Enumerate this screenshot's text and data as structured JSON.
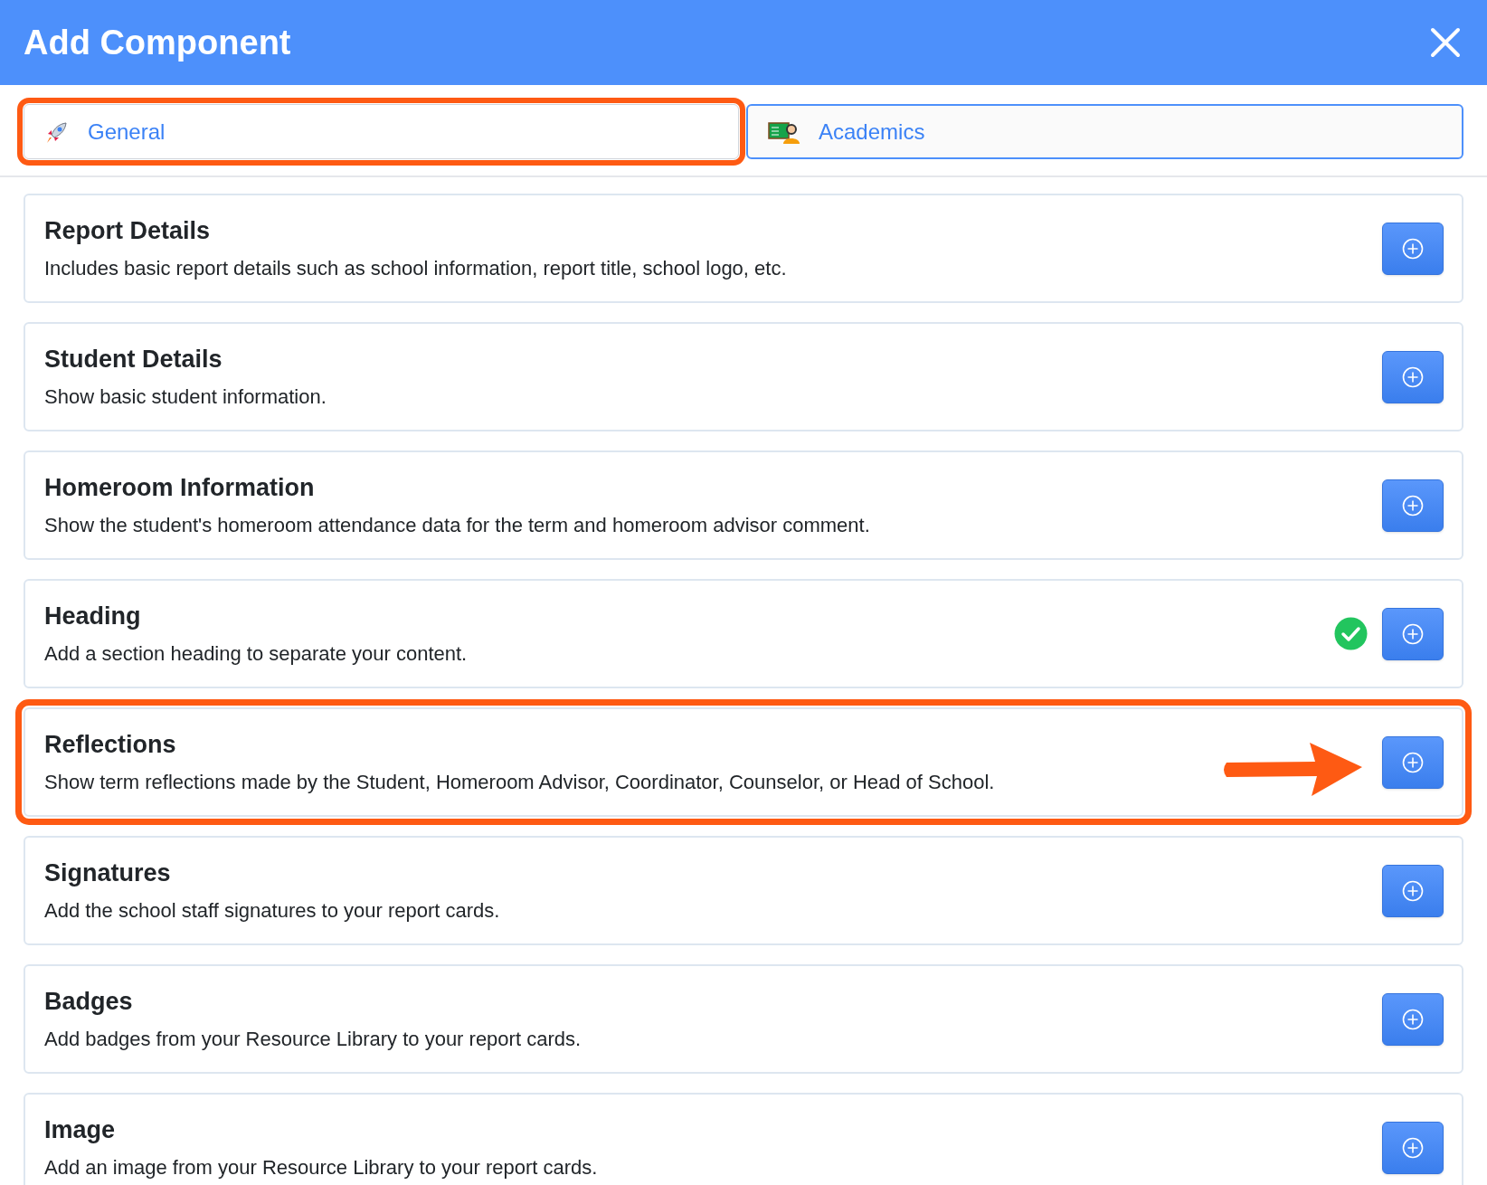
{
  "dialog": {
    "title": "Add Component"
  },
  "tabs": [
    {
      "label": "General",
      "selected": true,
      "highlighted": true
    },
    {
      "label": "Academics",
      "selected": false,
      "highlighted": false
    }
  ],
  "components": [
    {
      "title": "Report Details",
      "description": "Includes basic report details such as school information, report title, school logo, etc.",
      "added": false,
      "highlighted": false
    },
    {
      "title": "Student Details",
      "description": "Show basic student information.",
      "added": false,
      "highlighted": false
    },
    {
      "title": "Homeroom Information",
      "description": "Show the student's homeroom attendance data for the term and homeroom advisor comment.",
      "added": false,
      "highlighted": false
    },
    {
      "title": "Heading",
      "description": "Add a section heading to separate your content.",
      "added": true,
      "highlighted": false
    },
    {
      "title": "Reflections",
      "description": "Show term reflections made by the Student, Homeroom Advisor, Coordinator, Counselor, or Head of School.",
      "added": false,
      "highlighted": true
    },
    {
      "title": "Signatures",
      "description": "Add the school staff signatures to your report cards.",
      "added": false,
      "highlighted": false
    },
    {
      "title": "Badges",
      "description": "Add badges from your Resource Library to your report cards.",
      "added": false,
      "highlighted": false
    },
    {
      "title": "Image",
      "description": "Add an image from your Resource Library to your report cards.",
      "added": false,
      "highlighted": false
    }
  ]
}
